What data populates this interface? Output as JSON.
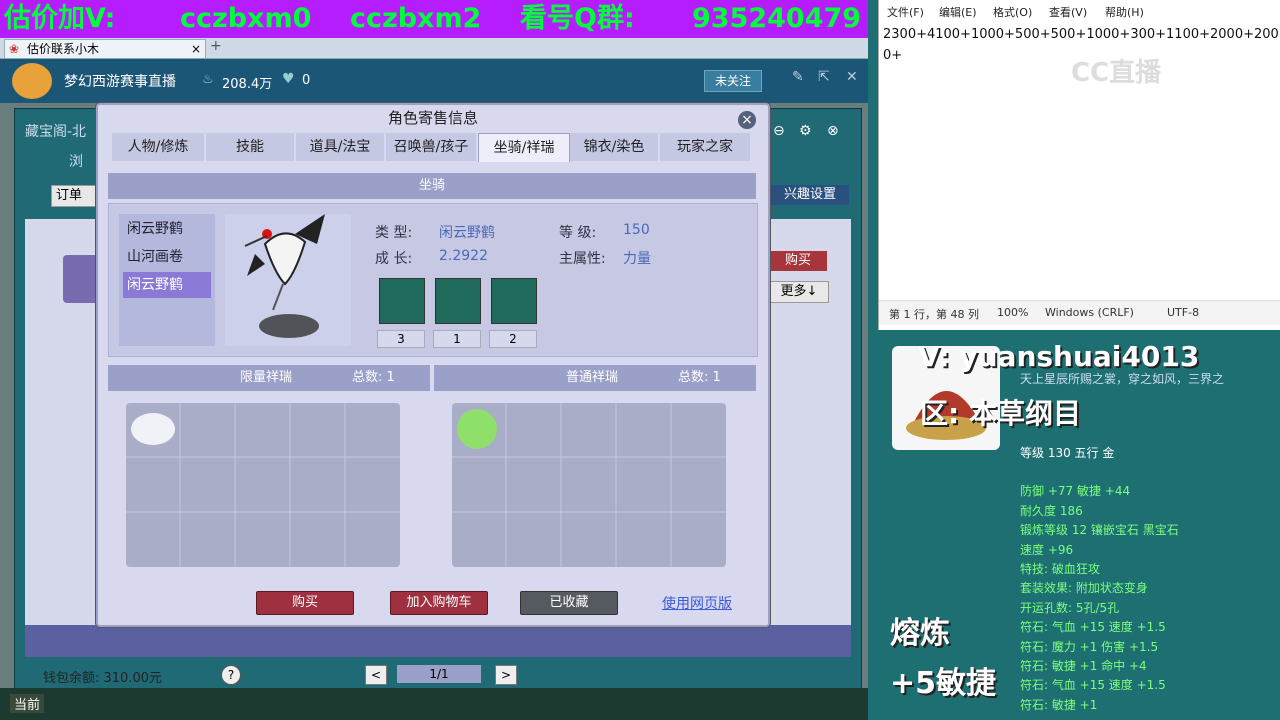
{
  "banner": {
    "part1": "估价加V:",
    "part2": "cczbxm0",
    "part3": "cczbxm2",
    "part4": "看号Q群:",
    "part5": "935240479"
  },
  "browser": {
    "tab_title": "估价联系小木"
  },
  "stream": {
    "title": "梦幻西游赛事直播",
    "views": "208.4万",
    "likes": "0",
    "follow_label": "未关注"
  },
  "game_bg": {
    "window_title": "藏宝阁-北",
    "browse_label": "浏",
    "order_label": "订单",
    "interest_label": "兴趣设置",
    "buy_label": "购买",
    "more_label": "更多↓",
    "wallet_label": "钱包余额: 310.00元",
    "help": "?",
    "prev": "<",
    "page": "1/1",
    "next": ">",
    "taskbar_label": "当前"
  },
  "dialog": {
    "title": "角色寄售信息",
    "close": "×",
    "tabs": [
      "人物/修炼",
      "技能",
      "道具/法宝",
      "召唤兽/孩子",
      "坐骑/祥瑞",
      "锦衣/染色",
      "玩家之家"
    ],
    "active_tab": 4,
    "section_mount": "坐骑",
    "mount_list": [
      "闲云野鹤",
      "山河画卷",
      "闲云野鹤"
    ],
    "selected_mount": 2,
    "type_label": "类  型:",
    "type_value": "闲云野鹤",
    "level_label": "等  级:",
    "level_value": "150",
    "growth_label": "成  长:",
    "growth_value": "2.2922",
    "attr_label": "主属性:",
    "attr_value": "力量",
    "skill_counts": [
      "3",
      "1",
      "2"
    ],
    "limited_title": "限量祥瑞",
    "limited_total": "总数: 1",
    "normal_title": "普通祥瑞",
    "normal_total": "总数: 1",
    "btn_buy": "购买",
    "btn_cart": "加入购物车",
    "btn_fav": "已收藏",
    "link_web": "使用网页版"
  },
  "notepad": {
    "menu": [
      "文件(F)",
      "编辑(E)",
      "格式(O)",
      "查看(V)",
      "帮助(H)"
    ],
    "content": "2300+4100+1000+500+500+1000+300+1100+2000+2000+",
    "status_pos": "第 1 行，第 48 列",
    "zoom": "100%",
    "eol": "Windows (CRLF)",
    "encoding": "UTF-8"
  },
  "overlay": {
    "wechat": "V: yuanshuai4013",
    "server": "区: 本草纲目",
    "refine": "熔炼",
    "bonus": "+5敏捷"
  },
  "item_tooltip": {
    "desc": "天上星辰所赐之裳，穿之如风，三界之",
    "lines": [
      "等级 130  五行 金",
      "防御 +77  敏捷 +44",
      "耐久度 186",
      "锻炼等级 12  镶嵌宝石 黑宝石",
      "速度 +96",
      "特技: 破血狂攻",
      "套装效果: 附加状态变身",
      "开运孔数: 5孔/5孔",
      "符石: 气血 +15  速度 +1.5",
      "符石: 魔力 +1  伤害 +1.5",
      "符石: 敏捷 +1  命中 +4",
      "符石: 气血 +15  速度 +1.5",
      "符石: 敏捷 +1"
    ]
  },
  "watermark": "CC直播"
}
